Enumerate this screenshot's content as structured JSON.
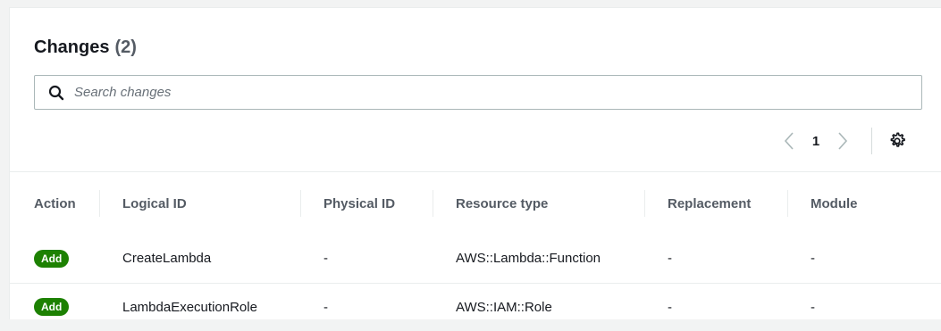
{
  "header": {
    "title": "Changes",
    "count": "(2)"
  },
  "search": {
    "placeholder": "Search changes",
    "value": ""
  },
  "pager": {
    "page": "1"
  },
  "table": {
    "columns": [
      "Action",
      "Logical ID",
      "Physical ID",
      "Resource type",
      "Replacement",
      "Module"
    ],
    "rows": [
      {
        "action": "Add",
        "logical_id": "CreateLambda",
        "physical_id": "-",
        "resource_type": "AWS::Lambda::Function",
        "replacement": "-",
        "module": "-"
      },
      {
        "action": "Add",
        "logical_id": "LambdaExecutionRole",
        "physical_id": "-",
        "resource_type": "AWS::IAM::Role",
        "replacement": "-",
        "module": "-"
      }
    ]
  },
  "colors": {
    "badge_green": "#1d8102",
    "header_text": "#545b64",
    "border": "#aab7b8"
  },
  "icons": {
    "search": "search-icon",
    "prev": "chevron-left-icon",
    "next": "chevron-right-icon",
    "settings": "gear-icon"
  }
}
